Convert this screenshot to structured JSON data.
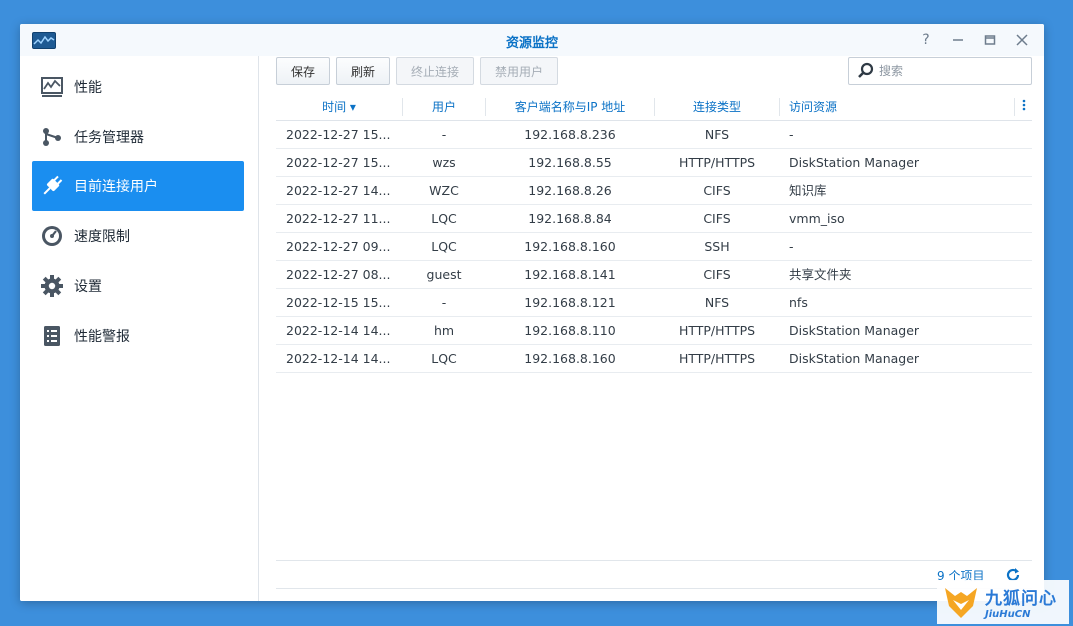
{
  "window": {
    "title": "资源监控"
  },
  "sidebar": {
    "items": [
      {
        "label": "性能",
        "icon": "performance-chart-icon"
      },
      {
        "label": "任务管理器",
        "icon": "task-manager-icon"
      },
      {
        "label": "目前连接用户",
        "icon": "plug-icon",
        "active": true
      },
      {
        "label": "速度限制",
        "icon": "speedometer-icon"
      },
      {
        "label": "设置",
        "icon": "gear-icon"
      },
      {
        "label": "性能警报",
        "icon": "alert-list-icon"
      }
    ]
  },
  "toolbar": {
    "save": "保存",
    "refresh": "刷新",
    "terminate": "终止连接",
    "disable_user": "禁用用户",
    "search_placeholder": "搜索"
  },
  "table": {
    "columns": [
      "时间",
      "用户",
      "客户端名称与IP 地址",
      "连接类型",
      "访问资源"
    ],
    "sort_indicator": "▾",
    "rows": [
      [
        "2022-12-27 15...",
        "-",
        "192.168.8.236",
        "NFS",
        "-"
      ],
      [
        "2022-12-27 15...",
        "wzs",
        "192.168.8.55",
        "HTTP/HTTPS",
        "DiskStation Manager"
      ],
      [
        "2022-12-27 14...",
        "WZC",
        "192.168.8.26",
        "CIFS",
        "知识库"
      ],
      [
        "2022-12-27 11...",
        "LQC",
        "192.168.8.84",
        "CIFS",
        "vmm_iso"
      ],
      [
        "2022-12-27 09...",
        "LQC",
        "192.168.8.160",
        "SSH",
        "-"
      ],
      [
        "2022-12-27 08...",
        "guest",
        "192.168.8.141",
        "CIFS",
        "共享文件夹"
      ],
      [
        "2022-12-15 15...",
        "-",
        "192.168.8.121",
        "NFS",
        "nfs"
      ],
      [
        "2022-12-14 14...",
        "hm",
        "192.168.8.110",
        "HTTP/HTTPS",
        "DiskStation Manager"
      ],
      [
        "2022-12-14 14...",
        "LQC",
        "192.168.8.160",
        "HTTP/HTTPS",
        "DiskStation Manager"
      ]
    ]
  },
  "footer": {
    "count": "9 个项目"
  },
  "watermark": {
    "cn": "九狐问心",
    "en": "JiuHuCN"
  },
  "colors": {
    "accent": "#1a8ef0",
    "title": "#0b72c6",
    "desktop": "#3d8fdc"
  }
}
